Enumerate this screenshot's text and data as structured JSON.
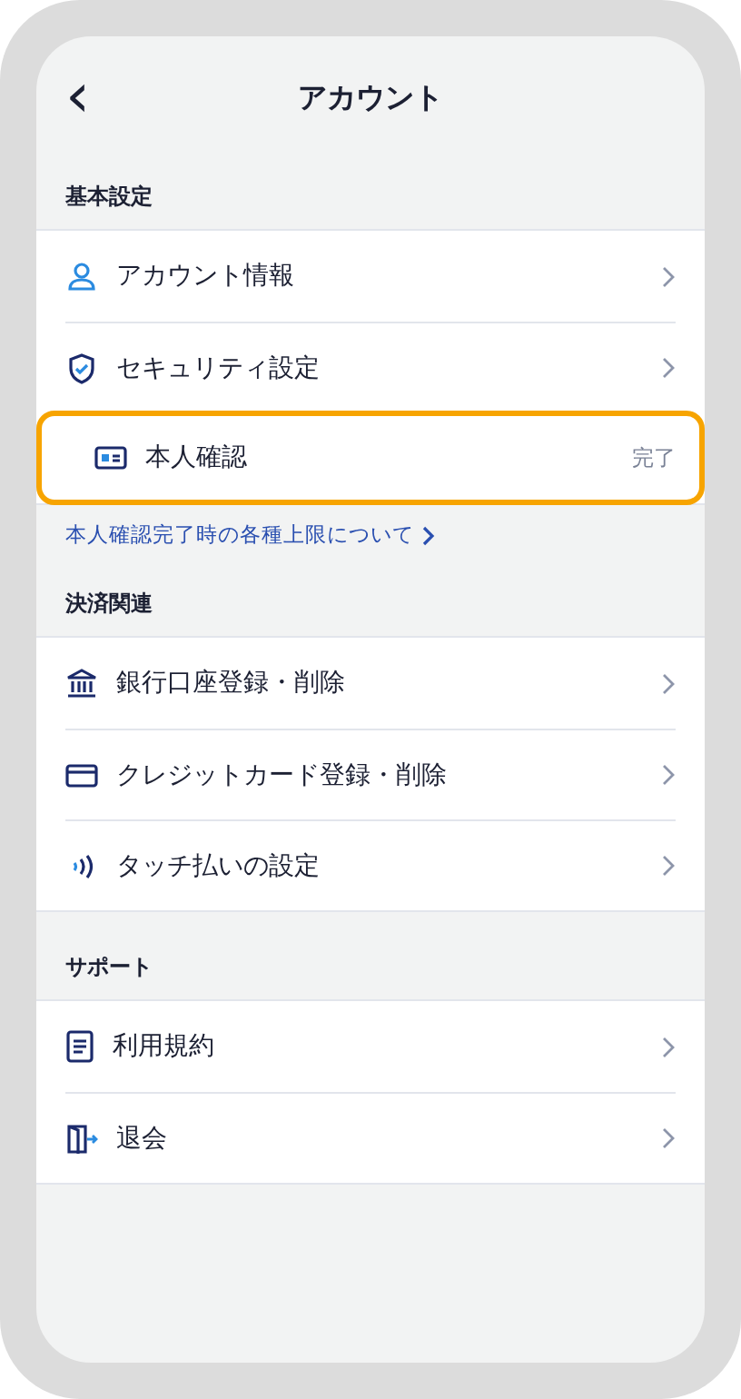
{
  "header": {
    "back": "‹",
    "title": "アカウント"
  },
  "sections": [
    {
      "title": "基本設定",
      "items": [
        {
          "label": "アカウント情報",
          "kind": "chevron",
          "highlighted": false
        },
        {
          "label": "セキュリティ設定",
          "kind": "chevron",
          "highlighted": false
        },
        {
          "label": "本人確認",
          "kind": "status",
          "status": "完了",
          "highlighted": true
        }
      ],
      "link": "本人確認完了時の各種上限について"
    },
    {
      "title": "決済関連",
      "items": [
        {
          "label": "銀行口座登録・削除",
          "kind": "chevron",
          "highlighted": false
        },
        {
          "label": "クレジットカード登録・削除",
          "kind": "chevron",
          "highlighted": false
        },
        {
          "label": "タッチ払いの設定",
          "kind": "chevron",
          "highlighted": false
        }
      ]
    },
    {
      "title": "サポート",
      "items": [
        {
          "label": "利用規約",
          "kind": "chevron",
          "highlighted": false
        },
        {
          "label": "退会",
          "kind": "chevron",
          "highlighted": false
        }
      ]
    }
  ]
}
